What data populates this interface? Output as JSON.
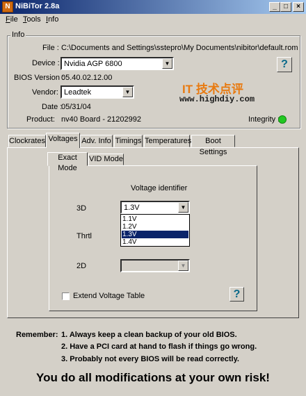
{
  "window": {
    "title": "NiBiTor 2.8a",
    "controls": {
      "minimize": "_",
      "maximize": "□",
      "close": "×"
    }
  },
  "menu": [
    {
      "label": "File",
      "mnemonic_index": 0
    },
    {
      "label": "Tools",
      "mnemonic_index": 0
    },
    {
      "label": "Info",
      "mnemonic_index": 0
    }
  ],
  "info": {
    "group_label": "Info",
    "file_label": "File :",
    "file_value": "C:\\Documents and Settings\\sstepro\\My Documents\\nibitor\\default.rom",
    "device_label": "Device :",
    "device_value": "Nvidia AGP 6800",
    "bios_label": "BIOS Version :",
    "bios_value": "05.40.02.12.00",
    "vendor_label": "Vendor:",
    "vendor_value": "Leadtek",
    "date_label": "Date :",
    "date_value": "05/31/04",
    "product_label": "Product:",
    "product_value": "nv40 Board - 21202992",
    "integrity_label": "Integrity :",
    "integrity_color": "#22c822",
    "help_label": "?"
  },
  "watermark": {
    "line1": "IT 技术点评",
    "line2": "www.highdiy.com"
  },
  "tabs": [
    {
      "label": "Clockrates",
      "active": false
    },
    {
      "label": "Voltages",
      "active": true
    },
    {
      "label": "Adv. Info",
      "active": false
    },
    {
      "label": "Timings",
      "active": false
    },
    {
      "label": "Temperatures",
      "active": false
    },
    {
      "label": "Boot Settings",
      "active": false
    }
  ],
  "voltages": {
    "subtabs": [
      {
        "label": "Exact Mode",
        "active": true
      },
      {
        "label": "VID Mode",
        "active": false
      }
    ],
    "identifier_label": "Voltage identifier",
    "row_3d_label": "3D",
    "row_3d_value": "1.3V",
    "row_thrtl_label": "Thrtl",
    "row_2d_label": "2D",
    "row_2d_value": "",
    "dropdown_options": [
      "1.1V",
      "1.2V",
      "1.3V",
      "1.4V"
    ],
    "dropdown_selected_index": 2,
    "extend_label": "Extend Voltage Table",
    "help_label": "?"
  },
  "footer": {
    "remember_label": "Remember:",
    "line1": "1. Always keep a clean backup of your old BIOS.",
    "line2": "2. Have a PCI card at hand to flash if things go wrong.",
    "line3": "3. Probably not every BIOS will be read correctly.",
    "risk": "You do all modifications at your own risk!"
  }
}
